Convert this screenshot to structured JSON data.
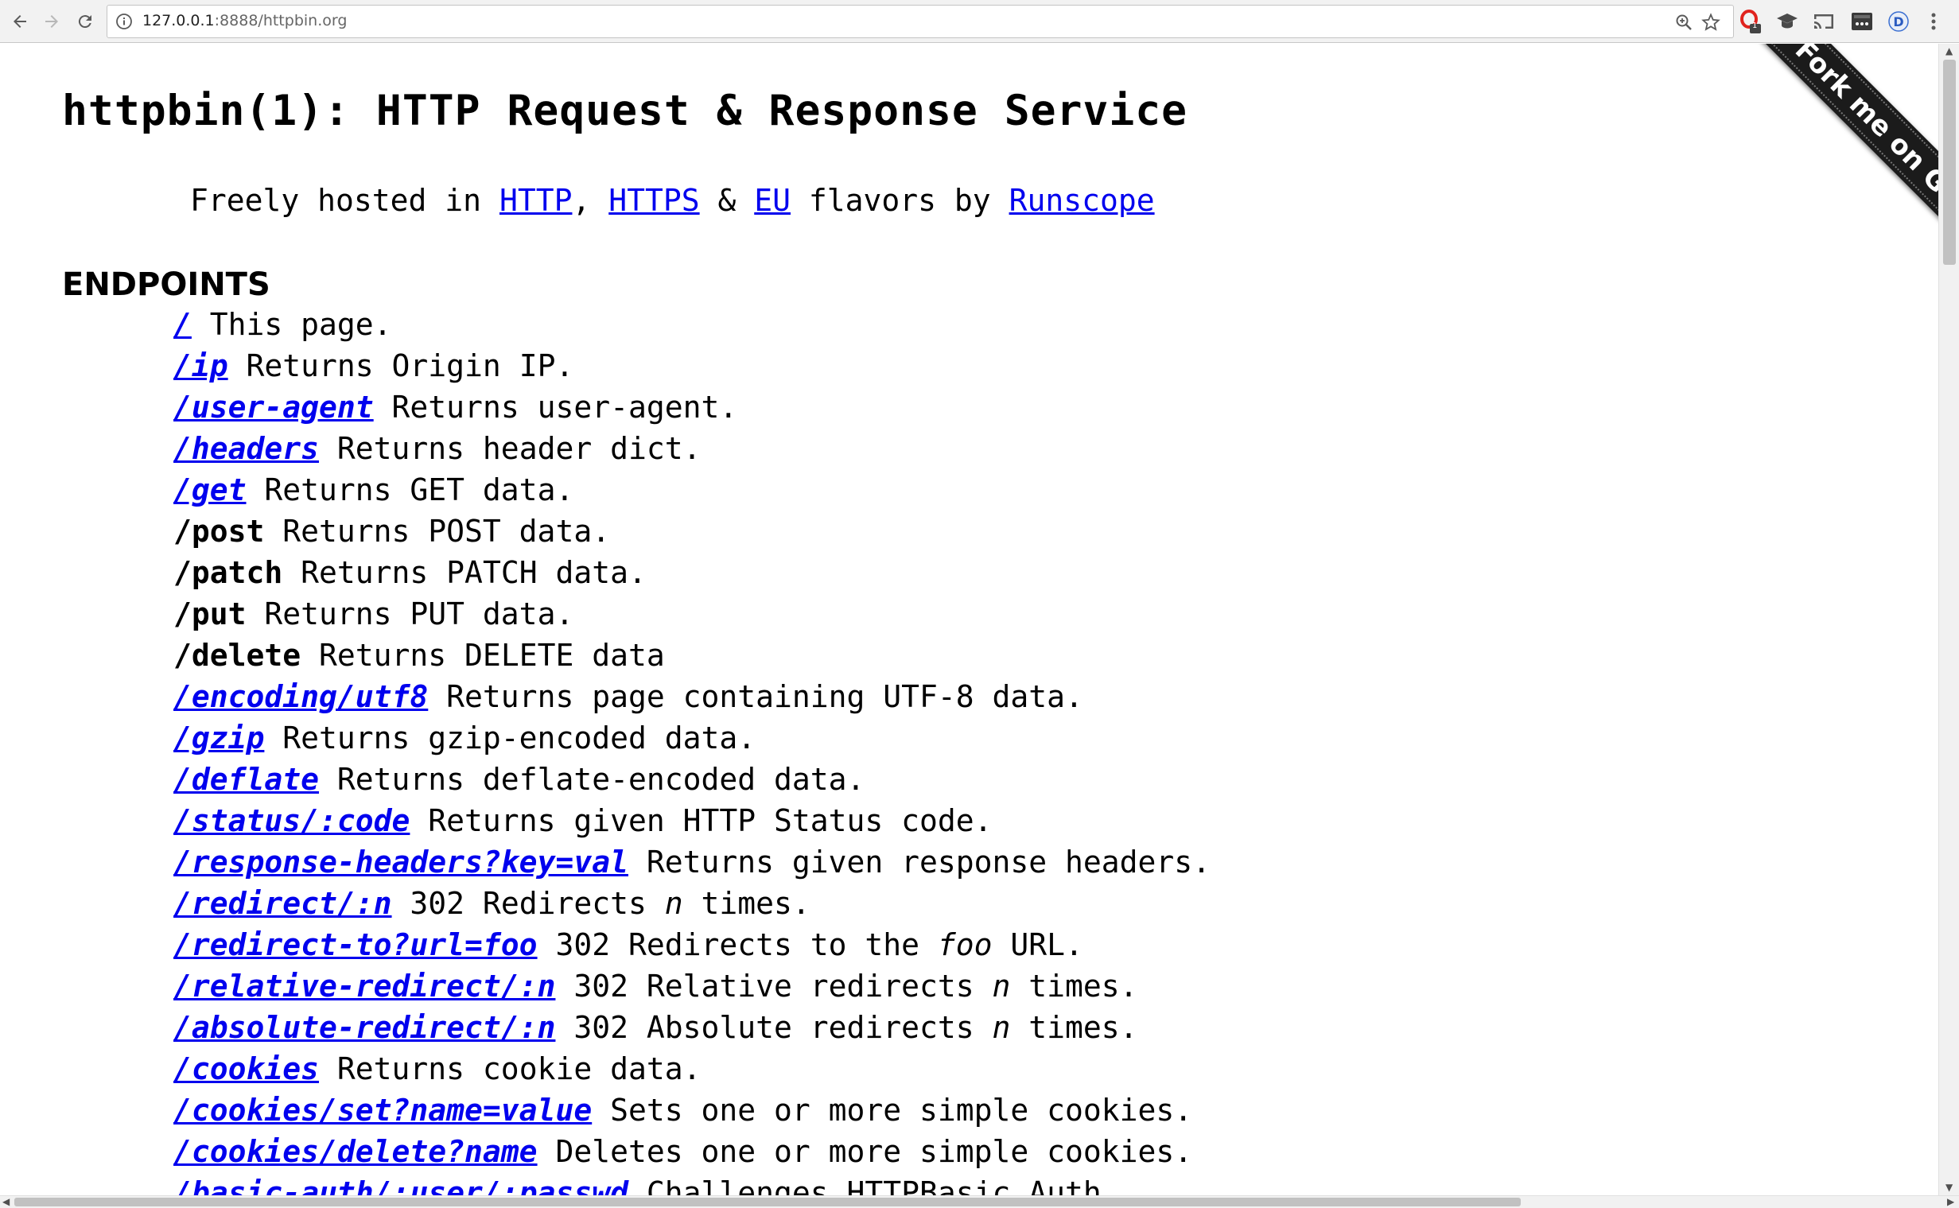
{
  "browser": {
    "url_host": "127.0.0.1",
    "url_rest": ":8888/httpbin.org",
    "extension_badge": "1"
  },
  "page": {
    "title": "httpbin(1): HTTP Request & Response Service",
    "subtitle": {
      "prefix": "Freely hosted in ",
      "link_http": "HTTP",
      "sep1": ", ",
      "link_https": "HTTPS",
      "sep2": " & ",
      "link_eu": "EU",
      "middle": " flavors by ",
      "link_runscope": "Runscope"
    },
    "endpoints_heading": "ENDPOINTS",
    "fork_ribbon": "Fork me on GitHub",
    "endpoints": [
      {
        "path": "/",
        "link": true,
        "desc": [
          {
            "t": " This page."
          }
        ]
      },
      {
        "path": "/ip",
        "link": true,
        "desc": [
          {
            "t": " Returns Origin IP."
          }
        ]
      },
      {
        "path": "/user-agent",
        "link": true,
        "desc": [
          {
            "t": " Returns user-agent."
          }
        ]
      },
      {
        "path": "/headers",
        "link": true,
        "desc": [
          {
            "t": " Returns header dict."
          }
        ]
      },
      {
        "path": "/get",
        "link": true,
        "desc": [
          {
            "t": " Returns GET data."
          }
        ]
      },
      {
        "path": "/post",
        "link": false,
        "desc": [
          {
            "t": " Returns POST data."
          }
        ]
      },
      {
        "path": "/patch",
        "link": false,
        "desc": [
          {
            "t": " Returns PATCH data."
          }
        ]
      },
      {
        "path": "/put",
        "link": false,
        "desc": [
          {
            "t": " Returns PUT data."
          }
        ]
      },
      {
        "path": "/delete",
        "link": false,
        "desc": [
          {
            "t": " Returns DELETE data"
          }
        ]
      },
      {
        "path": "/encoding/utf8",
        "link": true,
        "desc": [
          {
            "t": " Returns page containing UTF-8 data."
          }
        ]
      },
      {
        "path": "/gzip",
        "link": true,
        "desc": [
          {
            "t": " Returns gzip-encoded data."
          }
        ]
      },
      {
        "path": "/deflate",
        "link": true,
        "desc": [
          {
            "t": " Returns deflate-encoded data."
          }
        ]
      },
      {
        "path": "/status/:code",
        "link": true,
        "desc": [
          {
            "t": " Returns given HTTP Status code."
          }
        ]
      },
      {
        "path": "/response-headers?key=val",
        "link": true,
        "desc": [
          {
            "t": " Returns given response headers."
          }
        ]
      },
      {
        "path": "/redirect/:n",
        "link": true,
        "desc": [
          {
            "t": " 302 Redirects "
          },
          {
            "t": "n",
            "em": true
          },
          {
            "t": " times."
          }
        ]
      },
      {
        "path": "/redirect-to?url=foo",
        "link": true,
        "desc": [
          {
            "t": " 302 Redirects to the "
          },
          {
            "t": "foo",
            "em": true
          },
          {
            "t": " URL."
          }
        ]
      },
      {
        "path": "/relative-redirect/:n",
        "link": true,
        "desc": [
          {
            "t": " 302 Relative redirects "
          },
          {
            "t": "n",
            "em": true
          },
          {
            "t": " times."
          }
        ]
      },
      {
        "path": "/absolute-redirect/:n",
        "link": true,
        "desc": [
          {
            "t": " 302 Absolute redirects "
          },
          {
            "t": "n",
            "em": true
          },
          {
            "t": " times."
          }
        ]
      },
      {
        "path": "/cookies",
        "link": true,
        "desc": [
          {
            "t": " Returns cookie data."
          }
        ]
      },
      {
        "path": "/cookies/set?name=value",
        "link": true,
        "desc": [
          {
            "t": " Sets one or more simple cookies."
          }
        ]
      },
      {
        "path": "/cookies/delete?name",
        "link": true,
        "desc": [
          {
            "t": " Deletes one or more simple cookies."
          }
        ]
      },
      {
        "path": "/basic-auth/:user/:passwd",
        "link": true,
        "desc": [
          {
            "t": " Challenges HTTPBasic Auth."
          }
        ]
      }
    ]
  }
}
